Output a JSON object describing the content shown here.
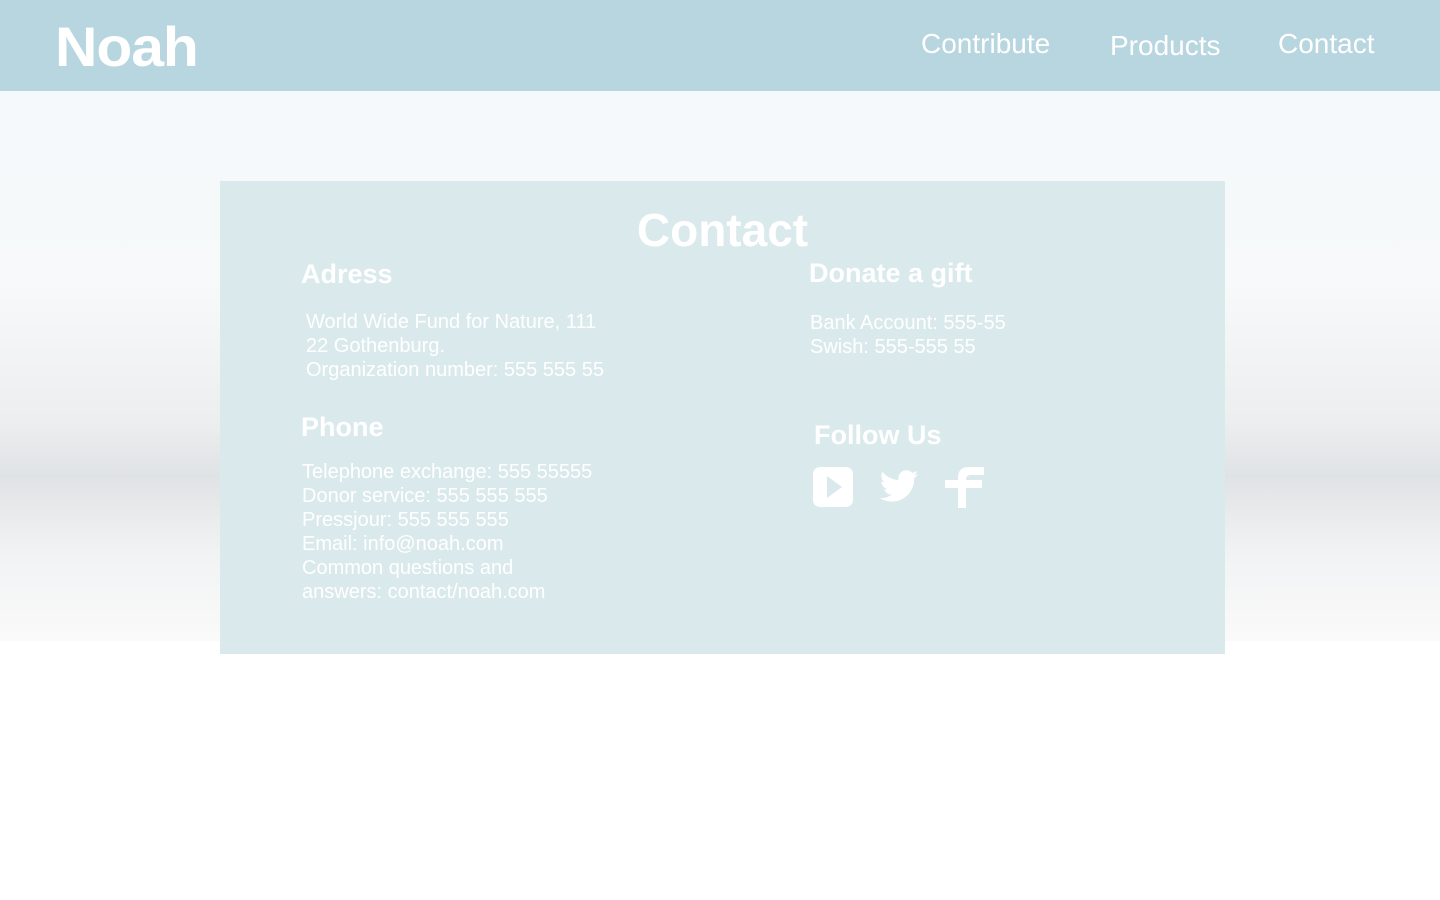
{
  "header": {
    "logo": "Noah",
    "nav": [
      "Contribute",
      "Products",
      "Contact"
    ]
  },
  "contact": {
    "title": "Contact",
    "address": {
      "heading": "Adress",
      "lines": [
        "World Wide Fund for Nature, 111",
        "22 Gothenburg.",
        "Organization number: 555 555 55"
      ]
    },
    "phone": {
      "heading": "Phone",
      "lines": [
        "Telephone exchange: 555 55555",
        "Donor service: 555 555 555",
        "Pressjour: 555 555 555",
        "Email: info@noah.com",
        "Common questions and",
        "answers: contact/noah.com"
      ]
    },
    "donate": {
      "heading": "Donate a gift",
      "lines": [
        "Bank Account: 555-55",
        "Swish: 555-555 55"
      ]
    },
    "follow": {
      "heading": "Follow Us",
      "icons": [
        "youtube-icon",
        "twitter-icon",
        "facebook-icon"
      ]
    }
  }
}
